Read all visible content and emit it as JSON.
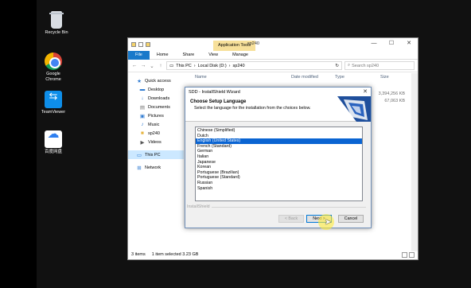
{
  "desktop": {
    "icons": [
      {
        "label": "Recycle Bin",
        "icon": "recycle-bin-icon"
      },
      {
        "label": "Google Chrome",
        "icon": "chrome-icon"
      },
      {
        "label": "TeamViewer",
        "icon": "teamviewer-icon"
      },
      {
        "label": "百度网盘",
        "icon": "baidu-netdisk-icon"
      }
    ]
  },
  "explorer": {
    "app_tools": "Application Tools",
    "title": "sp240",
    "tabs": [
      "File",
      "Home",
      "Share",
      "View",
      "Manage"
    ],
    "breadcrumb": [
      "This PC",
      "Local Disk (D:)",
      "sp240"
    ],
    "search_placeholder": "Search sp240",
    "columns": [
      "Name",
      "Date modified",
      "Type",
      "Size"
    ],
    "sizes": [
      "3,394,256 KB",
      "67,063 KB"
    ],
    "nav": [
      {
        "label": "Quick access",
        "icon": "star-icon"
      },
      {
        "label": "Desktop",
        "icon": "desktop-icon"
      },
      {
        "label": "Downloads",
        "icon": "download-icon"
      },
      {
        "label": "Documents",
        "icon": "documents-icon"
      },
      {
        "label": "Pictures",
        "icon": "pictures-icon"
      },
      {
        "label": "Music",
        "icon": "music-icon"
      },
      {
        "label": "sp240",
        "icon": "folder-icon"
      },
      {
        "label": "Videos",
        "icon": "videos-icon"
      },
      {
        "label": "This PC",
        "icon": "pc-icon"
      },
      {
        "label": "Network",
        "icon": "network-icon"
      }
    ],
    "status": {
      "items": "3 items",
      "selected": "1 item selected  3.23 GB"
    }
  },
  "wizard": {
    "title": "SDD - InstallShield Wizard",
    "heading": "Choose Setup Language",
    "description": "Select the language for the installation from the choices below.",
    "languages": [
      "Chinese (Simplified)",
      "Dutch",
      "English (United States)",
      "French (Standard)",
      "German",
      "Italian",
      "Japanese",
      "Korean",
      "Portuguese (Brazilian)",
      "Portuguese (Standard)",
      "Russian",
      "Spanish"
    ],
    "selected_index": 2,
    "footer_label": "InstallShield",
    "buttons": {
      "back": "< Back",
      "next": "Next >",
      "cancel": "Cancel"
    }
  }
}
